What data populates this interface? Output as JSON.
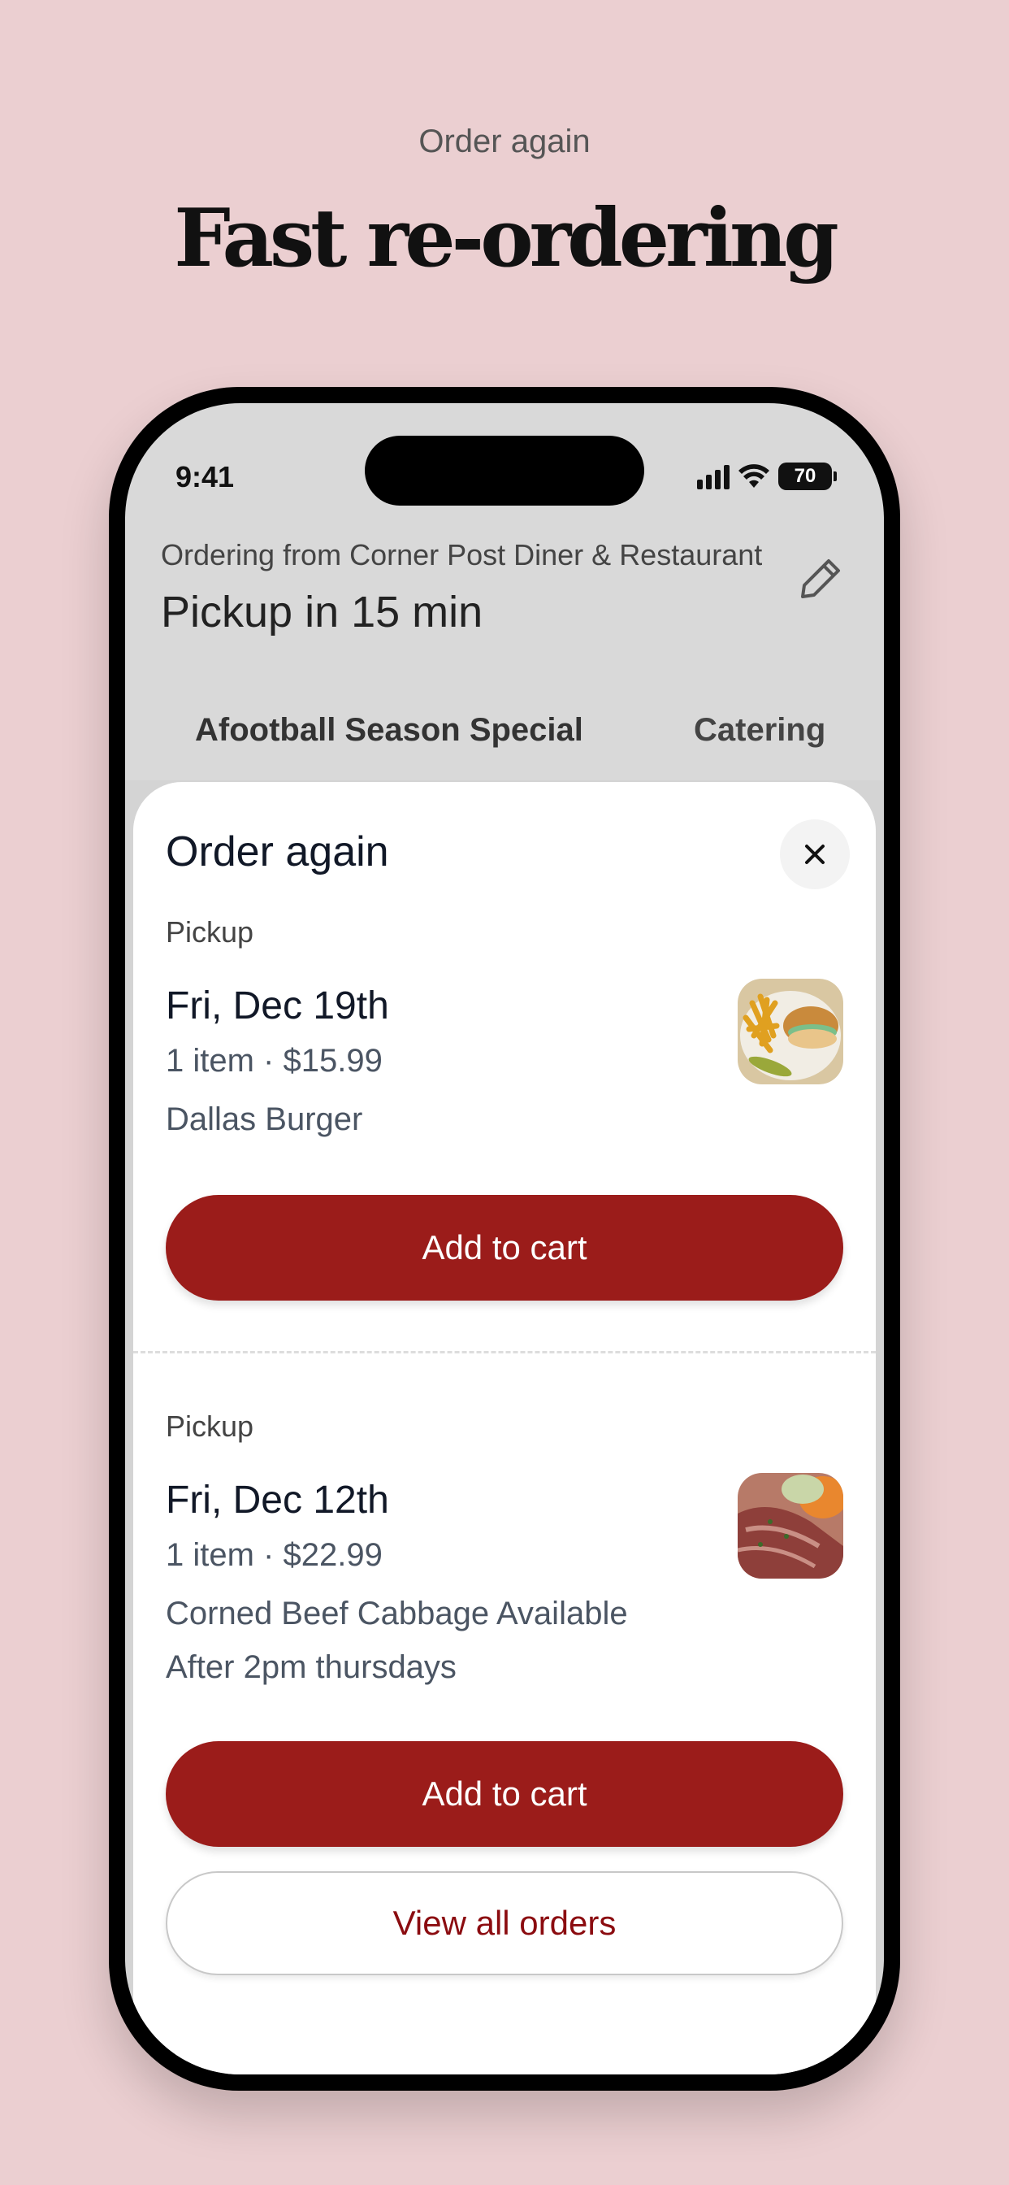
{
  "marketing": {
    "eyebrow": "Order again",
    "headline": "Fast re-ordering"
  },
  "status_bar": {
    "time": "9:41",
    "battery": "70",
    "icons": [
      "cellular-signal-icon",
      "wifi-icon",
      "battery-icon"
    ]
  },
  "header": {
    "ordering_from": "Ordering from Corner Post Diner & Restaurant",
    "pickup_time": "Pickup in 15 min",
    "edit_icon": "pencil-icon"
  },
  "menu_tabs": [
    {
      "label": "Afootball Season Special"
    },
    {
      "label": "Catering"
    }
  ],
  "sheet": {
    "title": "Order again",
    "close_icon": "close-icon",
    "orders": [
      {
        "type": "Pickup",
        "date": "Fri, Dec 19th",
        "meta": "1 item · $15.99",
        "item_name": "Dallas Burger",
        "image": "burger-and-fries-photo",
        "button": "Add to cart"
      },
      {
        "type": "Pickup",
        "date": "Fri, Dec 12th",
        "meta": "1 item · $22.99",
        "item_name": "Corned Beef Cabbage Available After 2pm thursdays",
        "image": "corned-beef-photo",
        "button": "Add to cart"
      }
    ],
    "view_all": "View all orders"
  },
  "colors": {
    "background": "#ebcfd1",
    "primary_button": "#9b1c1a",
    "link_text": "#8b0c10",
    "app_header_bg": "#d9d9d9"
  }
}
